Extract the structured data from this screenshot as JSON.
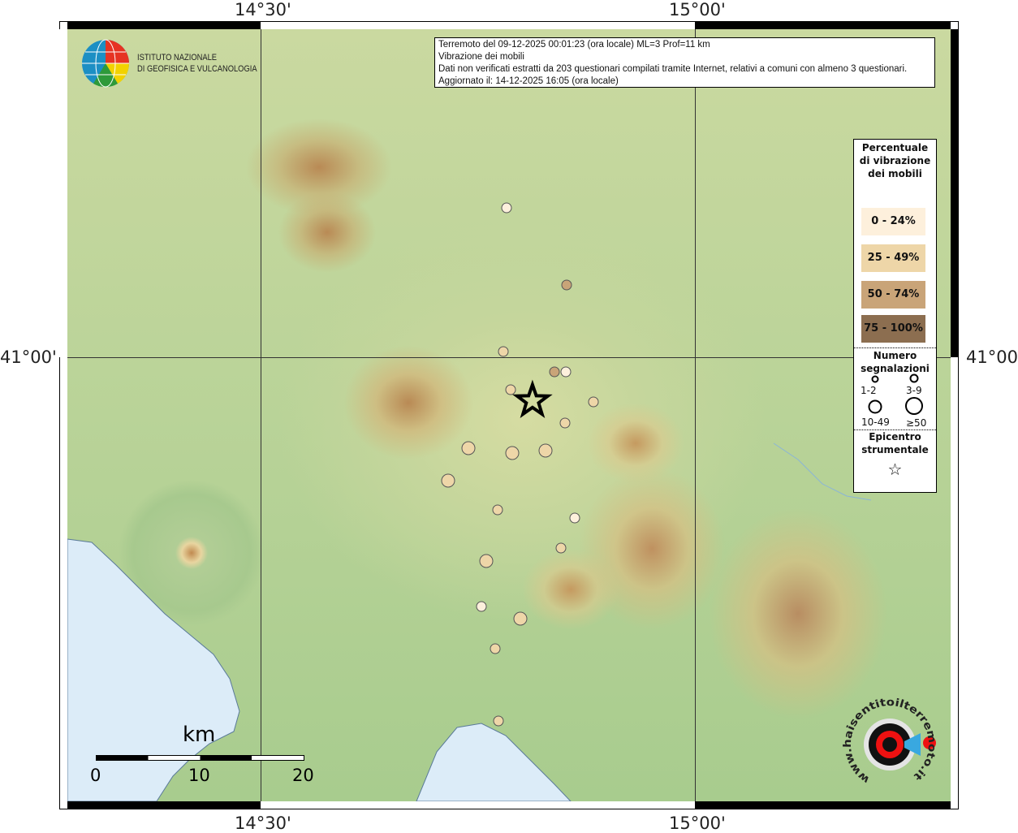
{
  "ticks": {
    "lon": [
      "14°30'",
      "15°00'"
    ],
    "lat": [
      "41°00'"
    ]
  },
  "info": {
    "lines": [
      "Terremoto del 09-12-2025 00:01:23 (ora locale) ML=3 Prof=11 km",
      "Vibrazione dei mobili",
      "Dati non verificati estratti da 203 questionari compilati tramite Internet, relativi a comuni con almeno 3 questionari.",
      "Aggiornato il: 14-12-2025 16:05 (ora locale)"
    ]
  },
  "logo_ingv": {
    "line1": "ISTITUTO NAZIONALE",
    "line2": "DI GEOFISICA E VULCANOLOGIA"
  },
  "logo_hsit": "www.haisentitoilterremoto.it",
  "legend": {
    "title": "Percentuale di vibrazione dei mobili",
    "classes": [
      {
        "label": "0 - 24%",
        "color": "#fdf0dc"
      },
      {
        "label": "25 - 49%",
        "color": "#eed6a8"
      },
      {
        "label": "50 - 74%",
        "color": "#c9a478"
      },
      {
        "label": "75 - 100%",
        "color": "#8c6e50"
      }
    ],
    "count_title": "Numero segnalazioni",
    "sizes": [
      "1-2",
      "3-9",
      "10-49",
      "≥50"
    ],
    "epicenter_title": "Epicentro strumentale"
  },
  "scale": {
    "unit": "km",
    "labels": [
      "0",
      "10",
      "20"
    ]
  },
  "epicenter": {
    "lon": 14.813,
    "lat": 40.962
  },
  "points": [
    {
      "lon": 14.783,
      "lat": 41.13,
      "class": 0,
      "size": "3-9"
    },
    {
      "lon": 14.852,
      "lat": 41.063,
      "class": 2,
      "size": "3-9"
    },
    {
      "lon": 14.779,
      "lat": 41.005,
      "class": 1,
      "size": "3-9"
    },
    {
      "lon": 14.838,
      "lat": 40.987,
      "class": 2,
      "size": "3-9"
    },
    {
      "lon": 14.851,
      "lat": 40.987,
      "class": 0,
      "size": "3-9"
    },
    {
      "lon": 14.788,
      "lat": 40.972,
      "class": 1,
      "size": "3-9"
    },
    {
      "lon": 14.883,
      "lat": 40.961,
      "class": 1,
      "size": "3-9"
    },
    {
      "lon": 14.85,
      "lat": 40.943,
      "class": 1,
      "size": "3-9"
    },
    {
      "lon": 14.739,
      "lat": 40.921,
      "class": 1,
      "size": "10-49"
    },
    {
      "lon": 14.79,
      "lat": 40.917,
      "class": 1,
      "size": "10-49"
    },
    {
      "lon": 14.828,
      "lat": 40.919,
      "class": 1,
      "size": "10-49"
    },
    {
      "lon": 14.716,
      "lat": 40.893,
      "class": 1,
      "size": "10-49"
    },
    {
      "lon": 14.773,
      "lat": 40.867,
      "class": 1,
      "size": "3-9"
    },
    {
      "lon": 14.862,
      "lat": 40.86,
      "class": 0,
      "size": "3-9"
    },
    {
      "lon": 14.846,
      "lat": 40.834,
      "class": 1,
      "size": "3-9"
    },
    {
      "lon": 14.76,
      "lat": 40.823,
      "class": 1,
      "size": "10-49"
    },
    {
      "lon": 14.754,
      "lat": 40.783,
      "class": 0,
      "size": "3-9"
    },
    {
      "lon": 14.799,
      "lat": 40.773,
      "class": 1,
      "size": "10-49"
    },
    {
      "lon": 14.77,
      "lat": 40.747,
      "class": 1,
      "size": "3-9"
    },
    {
      "lon": 14.774,
      "lat": 40.684,
      "class": 1,
      "size": "3-9"
    }
  ]
}
